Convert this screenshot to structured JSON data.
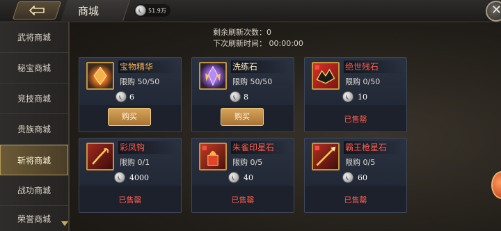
{
  "header": {
    "title": "商城",
    "currency_value": "51.9万"
  },
  "sidebar": {
    "items": [
      {
        "label": "武将商城"
      },
      {
        "label": "秘宝商城"
      },
      {
        "label": "竞技商城"
      },
      {
        "label": "贵族商城"
      },
      {
        "label": "斩将商城",
        "active": true
      },
      {
        "label": "战功商城"
      },
      {
        "label": "荣誉商城"
      }
    ]
  },
  "refresh": {
    "remaining_label": "剩余刷新次数：0",
    "next_label": "下次刷新时间：  00:00:00"
  },
  "items": [
    {
      "name": "宝物精华",
      "name_color": "gold",
      "limit": "限购  50/50",
      "price": "6",
      "action": "购买",
      "sold": false,
      "icon": "treasure-essence-icon"
    },
    {
      "name": "洗练石",
      "name_color": "gold",
      "limit": "限购  50/50",
      "price": "8",
      "action": "购买",
      "sold": false,
      "icon": "refining-stone-icon"
    },
    {
      "name": "绝世残石",
      "name_color": "red",
      "limit": "限购  0/50",
      "price": "10",
      "action": "已售罄",
      "sold": true,
      "icon": "peerless-fragment-icon"
    },
    {
      "name": "彩凤钩",
      "name_color": "red",
      "limit": "限购  0/1",
      "price": "4000",
      "action": "已售罄",
      "sold": true,
      "icon": "phoenix-hook-icon"
    },
    {
      "name": "朱雀印星石",
      "name_color": "red",
      "limit": "限购  0/5",
      "price": "40",
      "action": "已售罄",
      "sold": true,
      "icon": "vermilion-seal-star-stone-icon"
    },
    {
      "name": "霸王枪星石",
      "name_color": "red",
      "limit": "限购  0/5",
      "price": "60",
      "action": "已售罄",
      "sold": true,
      "icon": "overlord-spear-star-stone-icon"
    }
  ],
  "colors": {
    "gold_text": "#f4b35a",
    "red_text": "#ff5c4c",
    "card_bg": "#2a3140",
    "active_tab": "#6b5a36"
  }
}
